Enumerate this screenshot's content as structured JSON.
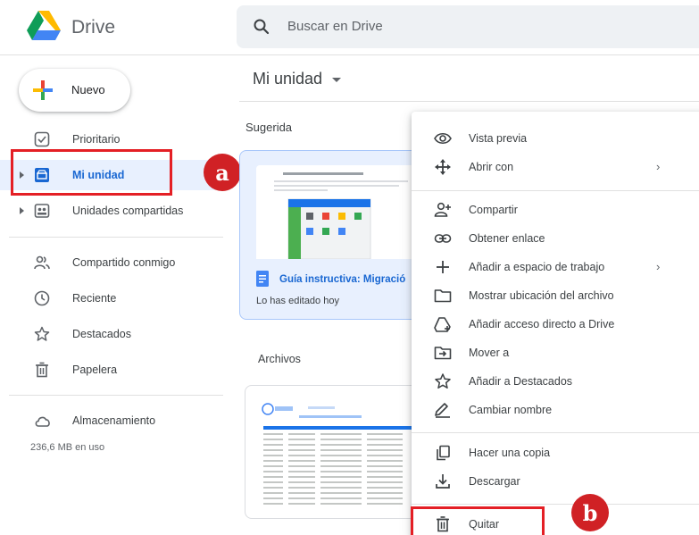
{
  "header": {
    "brand": "Drive",
    "search_placeholder": "Buscar en Drive"
  },
  "sidebar": {
    "new_label": "Nuevo",
    "items": [
      {
        "label": "Prioritario",
        "icon": "priority-check-icon"
      },
      {
        "label": "Mi unidad",
        "icon": "drive-icon",
        "active": true
      },
      {
        "label": "Unidades compartidas",
        "icon": "shared-drives-icon"
      },
      {
        "label": "Compartido conmigo",
        "icon": "people-icon"
      },
      {
        "label": "Reciente",
        "icon": "clock-icon"
      },
      {
        "label": "Destacados",
        "icon": "star-icon"
      },
      {
        "label": "Papelera",
        "icon": "trash-icon"
      },
      {
        "label": "Almacenamiento",
        "icon": "cloud-icon"
      }
    ],
    "storage_used": "236,6 MB en uso"
  },
  "main": {
    "breadcrumb": "Mi unidad",
    "suggested_label": "Sugerida",
    "suggested_card": {
      "title": "Guía instructiva: Migració",
      "subtitle": "Lo has editado hoy"
    },
    "files_label": "Archivos"
  },
  "context_menu": {
    "items": [
      {
        "label": "Vista previa",
        "icon": "eye-icon"
      },
      {
        "label": "Abrir con",
        "icon": "move-arrows-icon",
        "submenu": true
      },
      {
        "label": "Compartir",
        "icon": "add-person-icon"
      },
      {
        "label": "Obtener enlace",
        "icon": "link-icon"
      },
      {
        "label": "Añadir a espacio de trabajo",
        "icon": "plus-icon",
        "submenu": true
      },
      {
        "label": "Mostrar ubicación del archivo",
        "icon": "folder-icon"
      },
      {
        "label": "Añadir acceso directo a Drive",
        "icon": "shortcut-icon"
      },
      {
        "label": "Mover a",
        "icon": "move-to-icon"
      },
      {
        "label": "Añadir a Destacados",
        "icon": "star-icon"
      },
      {
        "label": "Cambiar nombre",
        "icon": "pencil-icon"
      },
      {
        "label": "Hacer una copia",
        "icon": "copy-icon"
      },
      {
        "label": "Descargar",
        "icon": "download-icon"
      },
      {
        "label": "Quitar",
        "icon": "trash-icon"
      }
    ]
  },
  "annotations": {
    "a": "a",
    "b": "b"
  },
  "colors": {
    "accent": "#1967d2",
    "active_bg": "#e8f0fe",
    "annotation_red": "#e41f25"
  }
}
